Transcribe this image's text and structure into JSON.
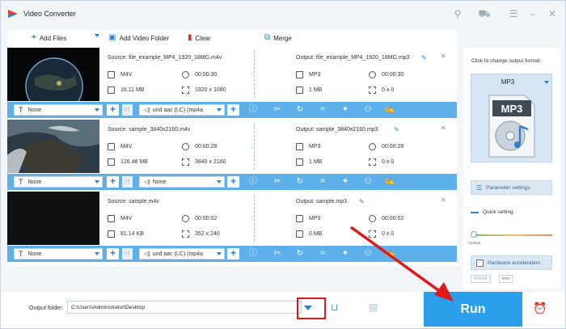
{
  "window": {
    "title": "Video Converter",
    "pin_icon": "pin-icon",
    "cart_icon": "cart-icon",
    "menu_icon": "menu-icon",
    "minimize_icon": "minimize-icon",
    "close_icon": "close-icon"
  },
  "toolbar": {
    "add_files": "Add Files",
    "add_video_folder": "Add Video Folder",
    "clear": "Clear",
    "merge": "Merge"
  },
  "files": [
    {
      "source": "Source: file_example_MP4_1920_18MG.m4v",
      "src_format": "M4V",
      "src_duration": "00:00:30",
      "src_size": "16.11 MB",
      "src_resolution": "1920 x 1080",
      "output": "Output: file_example_MP4_1920_18MG.mp3",
      "out_format": "MP3",
      "out_duration": "00:00:30",
      "out_size": "1 MB",
      "out_resolution": "0 x 0",
      "subtitle": "None",
      "audio": "und aac (LC) (mp4a"
    },
    {
      "source": "Source: sample_3840x2160.m4v",
      "src_format": "M4V",
      "src_duration": "00:00:28",
      "src_size": "126.48 MB",
      "src_resolution": "3840 x 2160",
      "output": "Output: sample_3840x2160.mp3",
      "out_format": "MP3",
      "out_duration": "00:00:28",
      "out_size": "1 MB",
      "out_resolution": "0 x 0",
      "subtitle": "None",
      "audio": "None"
    },
    {
      "source": "Source: sample.m4v",
      "src_format": "M4V",
      "src_duration": "00:00:02",
      "src_size": "81.14 KB",
      "src_resolution": "352 x 240",
      "output": "Output: sample.mp3",
      "out_format": "MP3",
      "out_duration": "00:00:02",
      "out_size": "0 MB",
      "out_resolution": "0 x 0",
      "subtitle": "None",
      "audio": "und aac (LC) (mp4a"
    }
  ],
  "edit_icons": [
    "info-icon",
    "scissors-icon",
    "rotate-icon",
    "crop-icon",
    "effects-icon",
    "watermark-icon",
    "subtitle-edit-icon"
  ],
  "right_panel": {
    "caption": "Click to change output format:",
    "format": "MP3",
    "parameter_settings": "Parameter settings",
    "quick_setting": "Quick setting",
    "slider_default": "Default",
    "hardware_acceleration": "Hardware acceleration",
    "nvidia": "NVIDIA",
    "intel": "intel"
  },
  "bottom": {
    "output_folder_label": "Output folder:",
    "output_folder_value": "C:\\Users\\Administrator\\Desktop",
    "run": "Run"
  },
  "colors": {
    "accent": "#2aa0ec",
    "edit_bar": "#5eb0ea",
    "highlight_box": "#e01818",
    "arrow": "#e01818"
  }
}
